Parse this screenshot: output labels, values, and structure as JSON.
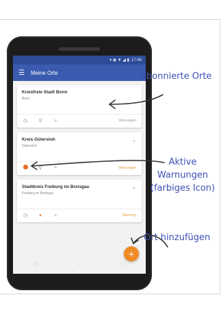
{
  "status_bar": {
    "icons": "▾ ◉ ▼ ◢ ▮",
    "time": "17:46"
  },
  "app_bar": {
    "menu_icon": "menu-icon",
    "title": "Meine Orte"
  },
  "cards": [
    {
      "title": "Kreisfreie Stadt Bonn",
      "subtitle": "Bonn",
      "chevron": "",
      "status": "Warnungen"
    },
    {
      "title": "Kreis Gütersloh",
      "subtitle": "Gütersloh",
      "chevron": "⌄",
      "status": "Warnungen"
    },
    {
      "title": "Stadtkreis Freiburg im Breisgau",
      "subtitle": "Freiburg im Breisgau",
      "chevron": "⌄",
      "status": "Warnung"
    }
  ],
  "fab": {
    "label": "+"
  },
  "nav": {
    "back": "◁",
    "home": "○",
    "recents": "□"
  },
  "annotations": {
    "subscribed": "Abonnierte Orte",
    "active_warnings_1": "Aktive",
    "active_warnings_2": "Warnungen",
    "active_warnings_3": "(farbiges Icon)",
    "add_place": "Ort hinzufügen"
  },
  "colors": {
    "app_bar": "#3a5bb0",
    "accent": "#f08a24",
    "annotation": "#3b4fb5"
  }
}
